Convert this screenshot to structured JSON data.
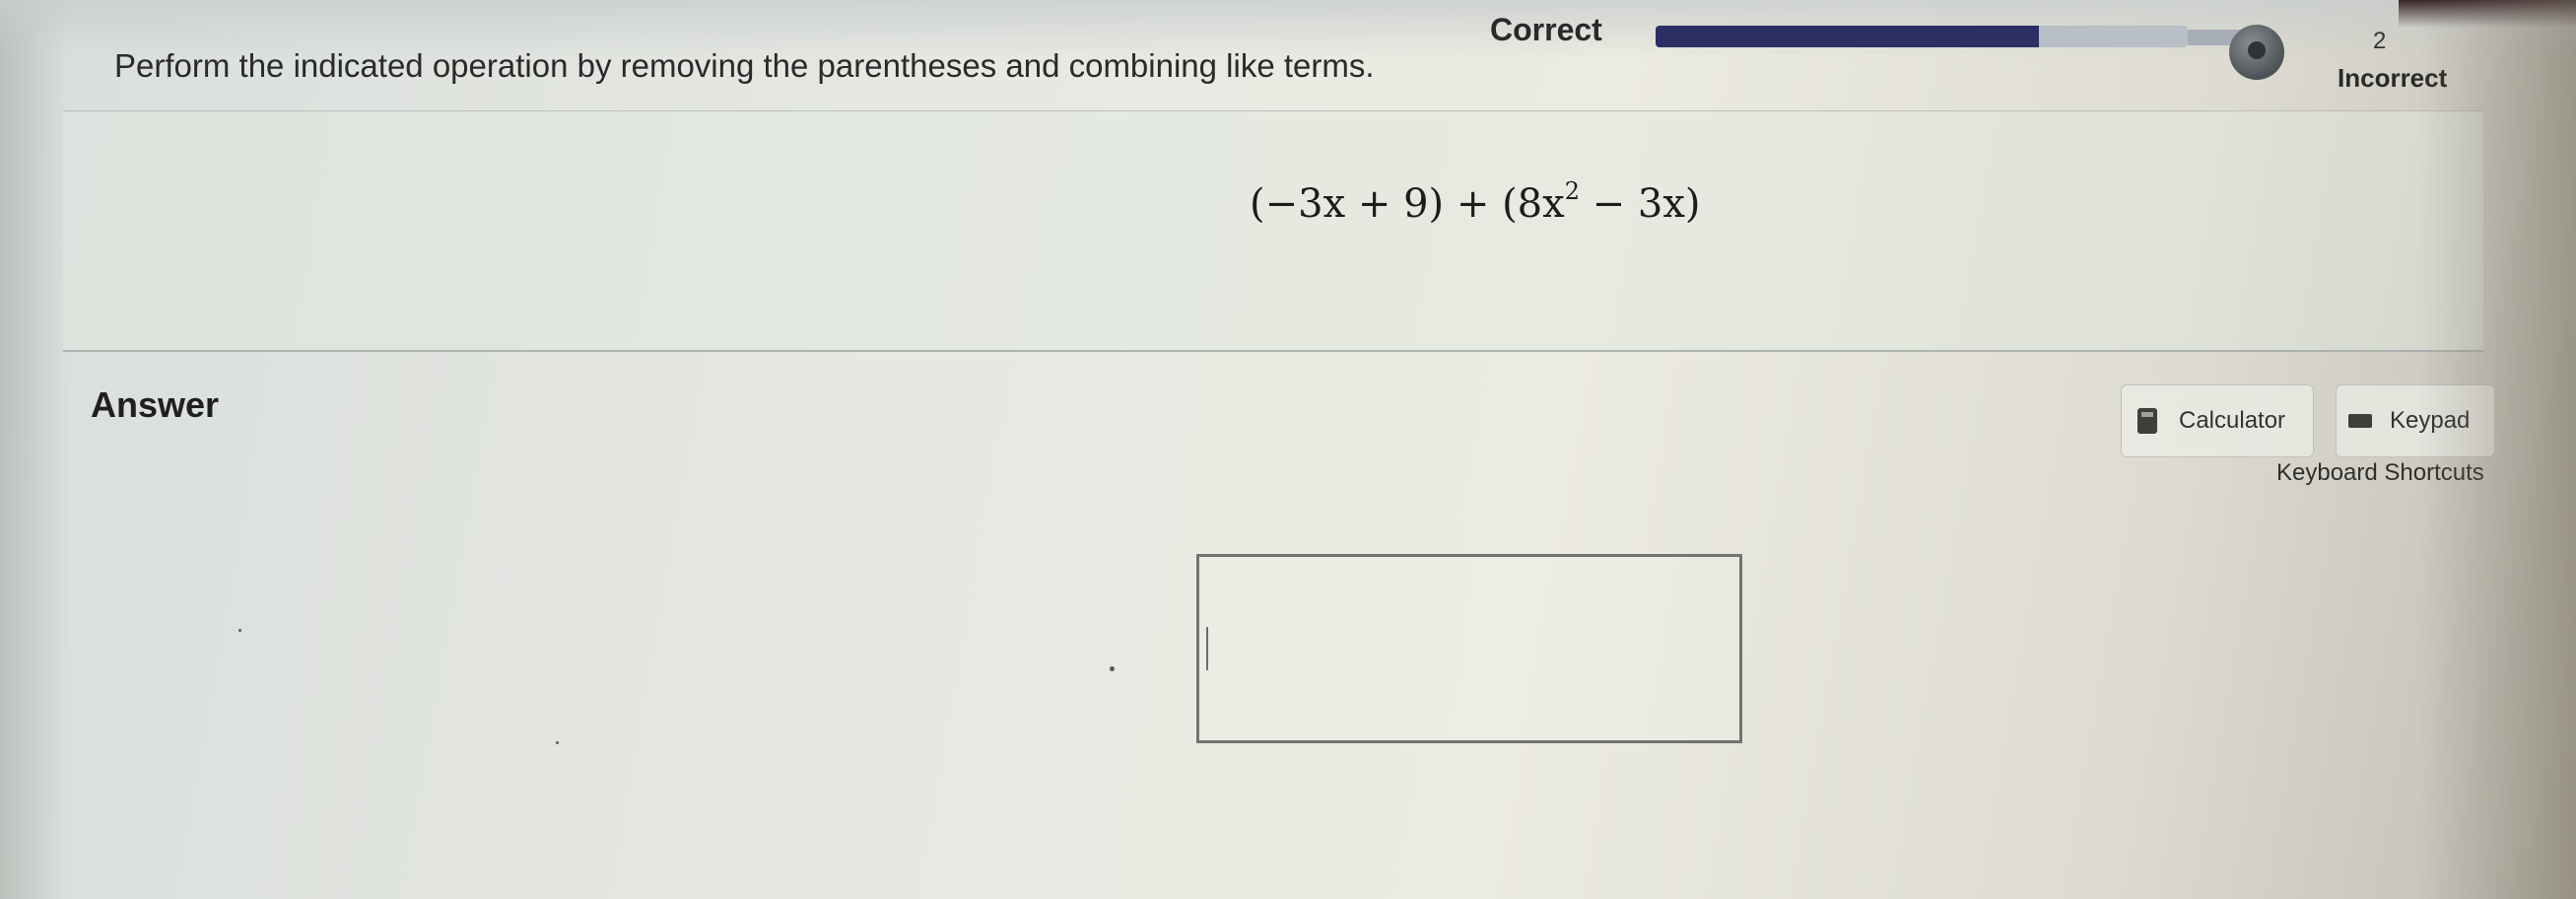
{
  "header": {
    "correct_label": "Correct",
    "progress_fraction": 0.72,
    "incorrect_count": "2",
    "incorrect_label": "Incorrect"
  },
  "question": {
    "instruction": "Perform the indicated operation by removing the parentheses and combining like terms.",
    "expression_part1": "(−3x + 9) + (8x",
    "expression_exponent": "2",
    "expression_part2": " − 3x)"
  },
  "answer": {
    "heading": "Answer",
    "calculator_label": "Calculator",
    "keypad_label": "Keypad",
    "shortcuts_label": "Keyboard Shortcuts",
    "input_value": ""
  },
  "icons": {
    "calculator": "calculator-icon",
    "keypad": "keyboard-icon"
  },
  "colors": {
    "progress_fill": "#2c2f63",
    "progress_track": "#b9bfc6"
  }
}
